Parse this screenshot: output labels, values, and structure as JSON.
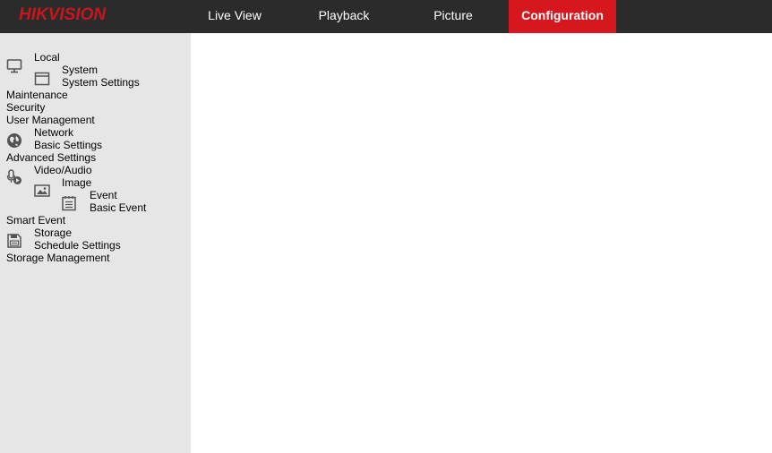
{
  "header": {
    "logo_text": "HIKVISION",
    "nav": [
      {
        "label": "Live View",
        "active": false
      },
      {
        "label": "Playback",
        "active": false
      },
      {
        "label": "Picture",
        "active": false
      },
      {
        "label": "Configuration",
        "active": true
      }
    ],
    "colors": {
      "bar": "#2b2b2b",
      "active": "#d7171e",
      "logo": "#c8161d"
    }
  },
  "sidebar": {
    "items": [
      {
        "label": "Local",
        "icon": "monitor-icon"
      },
      {
        "label": "System",
        "icon": "window-icon"
      },
      {
        "label": "System Settings"
      },
      {
        "label": "Maintenance"
      },
      {
        "label": "Security"
      },
      {
        "label": "User Management"
      },
      {
        "label": "Network",
        "icon": "globe-icon"
      },
      {
        "label": "Basic Settings"
      },
      {
        "label": "Advanced Settings"
      },
      {
        "label": "Video/Audio",
        "icon": "microphone-icon"
      },
      {
        "label": "Image",
        "icon": "image-icon"
      },
      {
        "label": "Event",
        "icon": "event-list-icon"
      },
      {
        "label": "Basic Event"
      },
      {
        "label": "Smart Event"
      },
      {
        "label": "Storage",
        "icon": "storage-disk-icon"
      },
      {
        "label": "Schedule Settings"
      },
      {
        "label": "Storage Management"
      }
    ]
  }
}
